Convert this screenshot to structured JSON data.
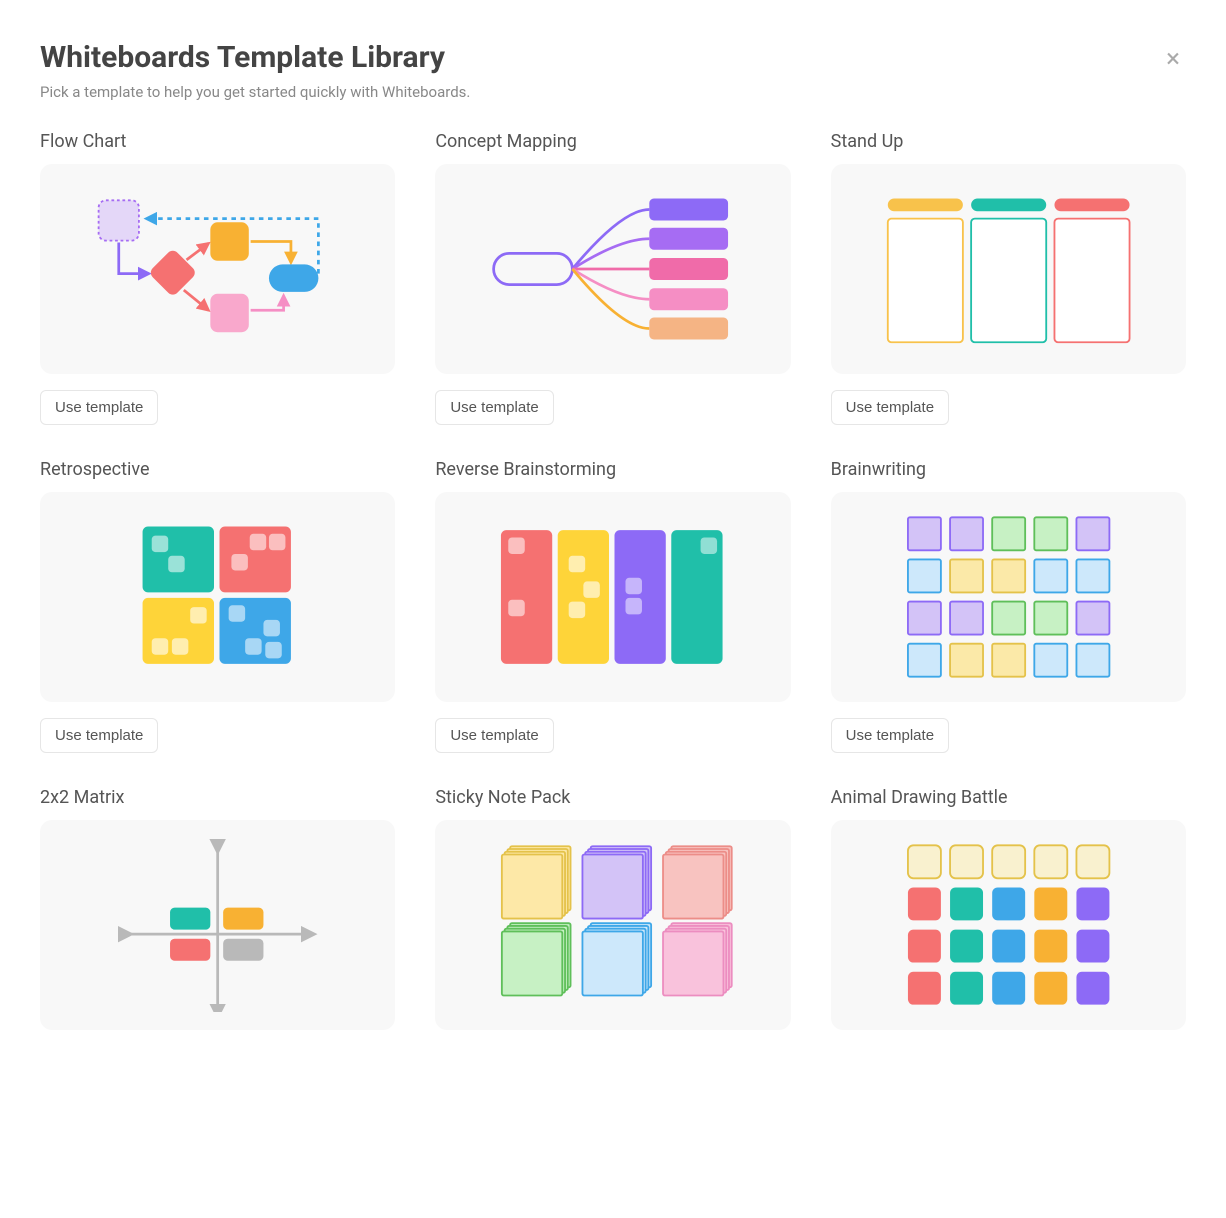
{
  "header": {
    "title": "Whiteboards Template Library",
    "subtitle": "Pick a template to help you get started quickly with Whiteboards.",
    "close_icon": "×"
  },
  "use_label": "Use template",
  "templates": [
    {
      "id": "flow-chart",
      "title": "Flow Chart"
    },
    {
      "id": "concept-mapping",
      "title": "Concept Mapping"
    },
    {
      "id": "stand-up",
      "title": "Stand Up"
    },
    {
      "id": "retrospective",
      "title": "Retrospective"
    },
    {
      "id": "reverse-brainstorming",
      "title": "Reverse Brainstorming"
    },
    {
      "id": "brainwriting",
      "title": "Brainwriting"
    },
    {
      "id": "2x2-matrix",
      "title": "2x2 Matrix"
    },
    {
      "id": "sticky-note-pack",
      "title": "Sticky Note Pack"
    },
    {
      "id": "animal-drawing-battle",
      "title": "Animal Drawing Battle"
    }
  ],
  "palette": {
    "lavender": "#e4d7f8",
    "purple": "#8d6af6",
    "violet": "#a66cf3",
    "pink": "#f58ec4",
    "hotpink": "#f06ba9",
    "red": "#f57171",
    "orange": "#f8b133",
    "yellow": "#fed439",
    "teal": "#20bfa9",
    "blue": "#3ea7e8",
    "lightblue": "#a8d6f9",
    "green": "#8fe28b",
    "cream": "#f6eabc",
    "grey": "#b9b9b9",
    "peach": "#f5b484",
    "salmon": "#f59b90"
  }
}
